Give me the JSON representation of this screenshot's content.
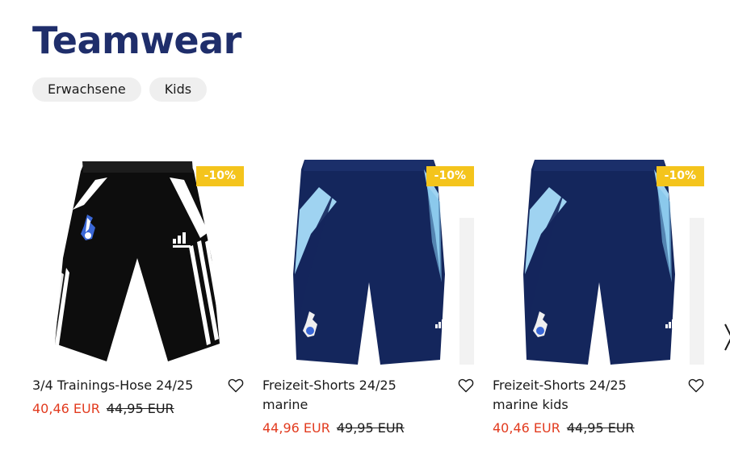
{
  "page": {
    "title": "Teamwear"
  },
  "filters": [
    {
      "label": "Erwachsene"
    },
    {
      "label": "Kids"
    }
  ],
  "products": [
    {
      "name": "3/4 Trainings-Hose 24/25",
      "price": "40,46 EUR",
      "old_price": "44,95 EUR",
      "badge": "-10%",
      "image": "black-three-quarter-pants"
    },
    {
      "name": "Freizeit-Shorts 24/25 marine",
      "price": "44,96 EUR",
      "old_price": "49,95 EUR",
      "badge": "-10%",
      "image": "navy-shorts"
    },
    {
      "name": "Freizeit-Shorts 24/25 marine kids",
      "price": "40,46 EUR",
      "old_price": "44,95 EUR",
      "badge": "-10%",
      "image": "navy-shorts-kids"
    }
  ],
  "colors": {
    "title": "#1f2e6b",
    "sale_price": "#e23b1f",
    "badge": "#f4c41c",
    "chip_bg": "#efefef"
  },
  "icons": {
    "wishlist": "heart-outline-icon"
  }
}
